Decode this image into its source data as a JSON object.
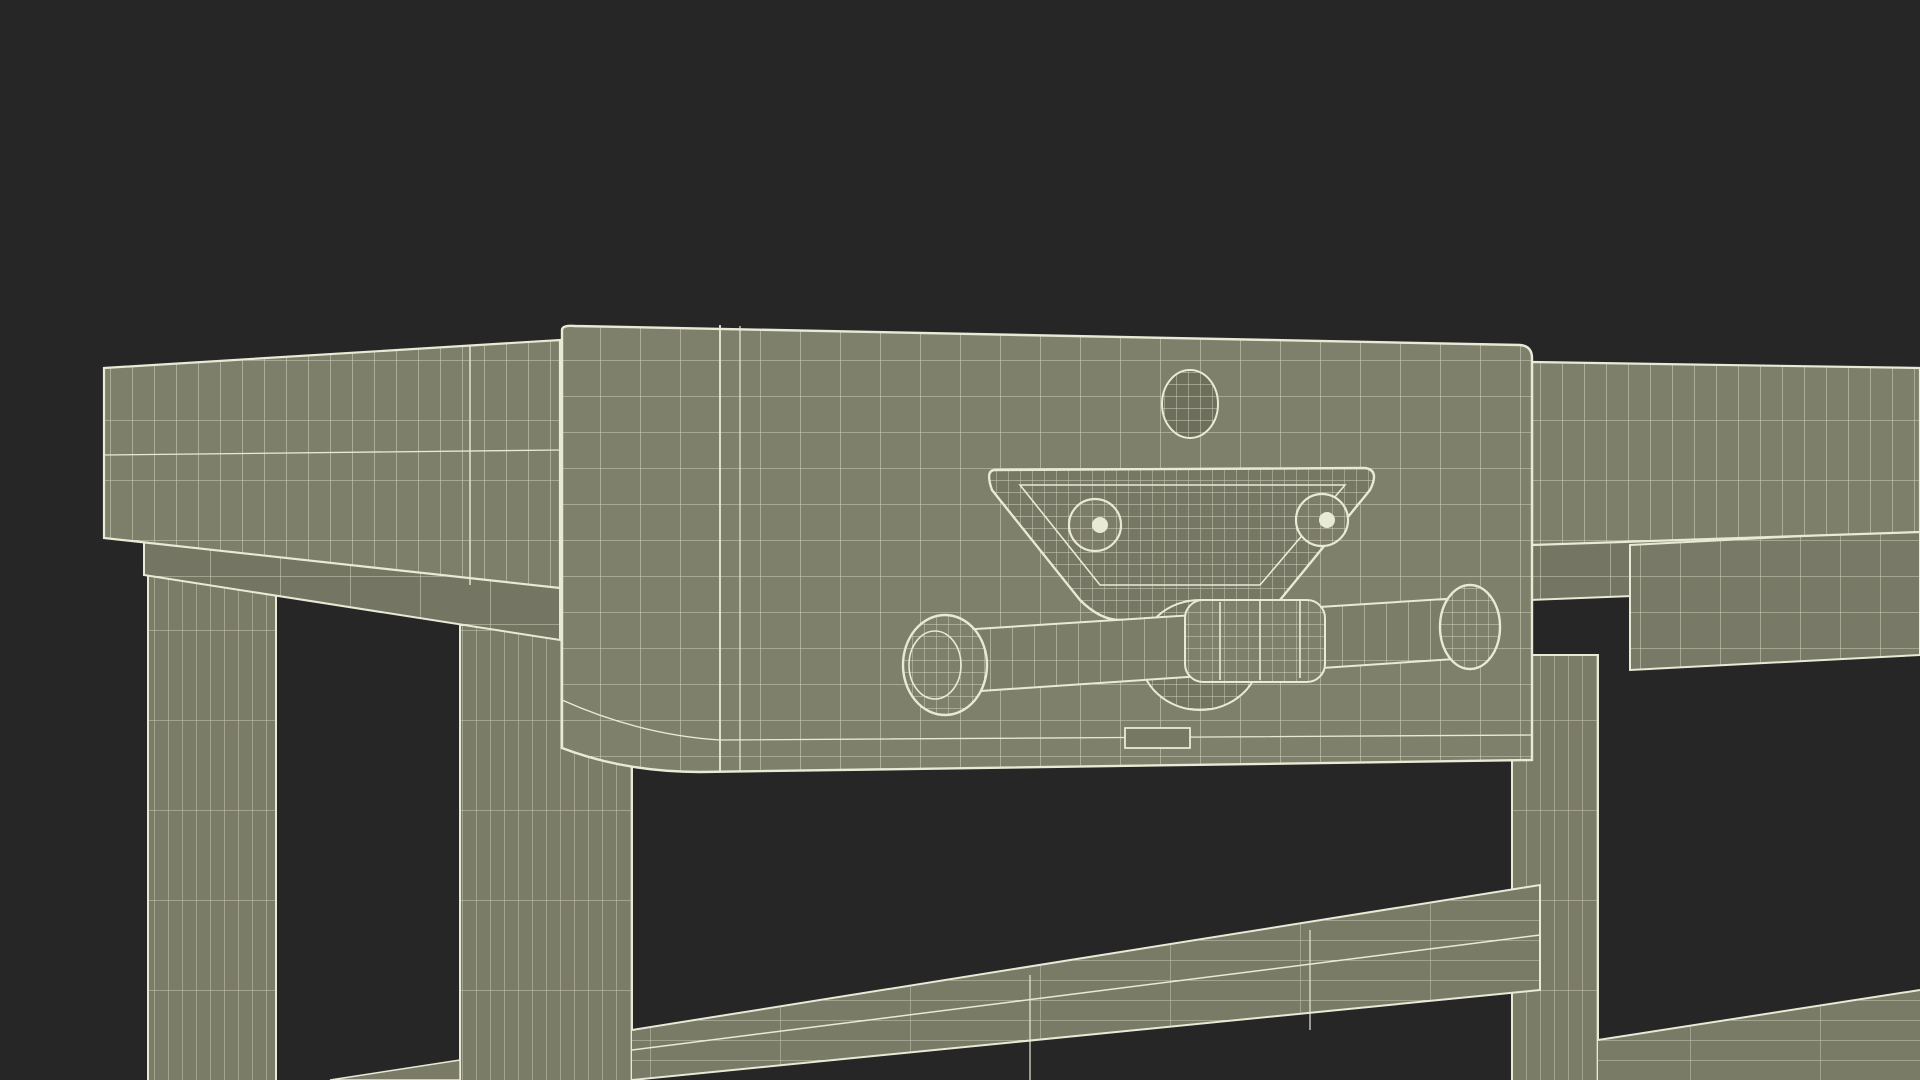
{
  "scene": {
    "background_color": "#262626",
    "surface_color": "#7e7f6b",
    "surface_shadow_color": "#6f705e",
    "wire_color": "#e9ead6"
  }
}
